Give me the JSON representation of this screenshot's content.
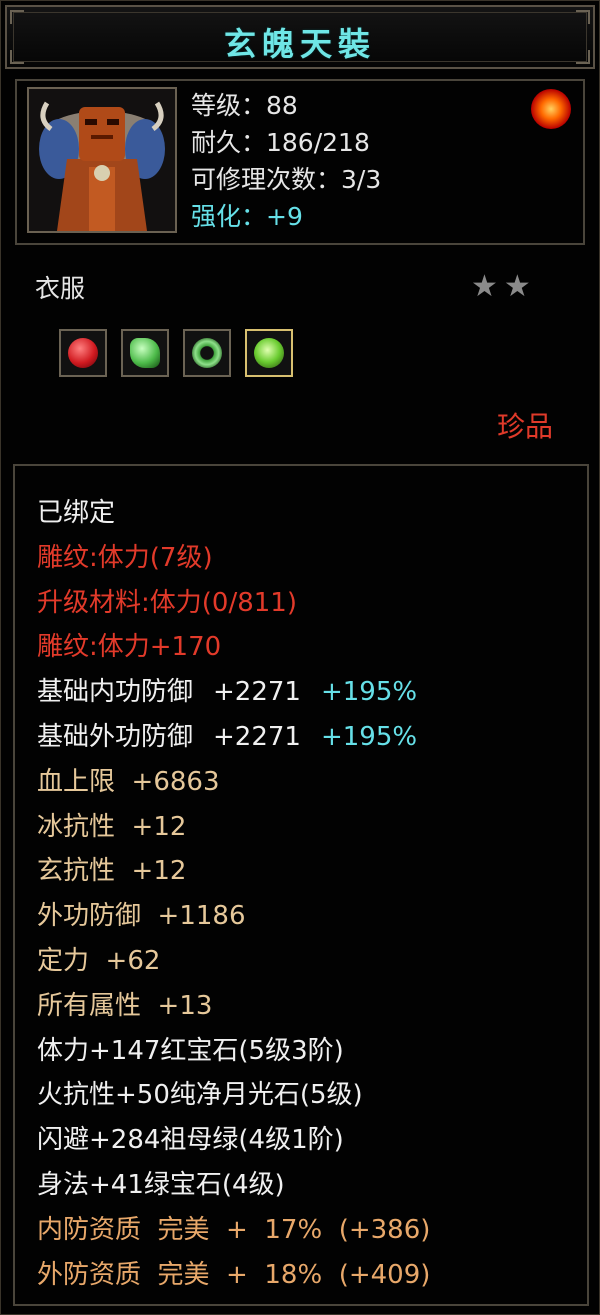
{
  "title": "玄魄天裝",
  "header": {
    "level_label": "等级：88",
    "durability_label": "耐久：186/218",
    "repair_label": "可修理次数：3/3",
    "enhance_label": "强化：+9",
    "portrait_icon": "tribal-mask-armor-icon",
    "orb_icon": "fire-orb-icon"
  },
  "slot": {
    "label": "衣服",
    "stars": "★★",
    "rarity": "珍品"
  },
  "gems": [
    {
      "icon": "red-gem-icon",
      "color": "#d01a20"
    },
    {
      "icon": "green-jade-icon",
      "color": "#4dbb4a"
    },
    {
      "icon": "green-ring-icon",
      "color": "#3fa23c"
    },
    {
      "icon": "green-crystal-icon",
      "color": "#6acc30"
    }
  ],
  "attributes": {
    "bound": "已绑定",
    "carving": "雕纹:体力(7级)",
    "upgrade": "升级材料:体力(0/811)",
    "carving_bonus": "雕纹:体力+170",
    "inner_def": {
      "name": "基础内功防御",
      "value": "+2271",
      "pct": "+195%"
    },
    "outer_def": {
      "name": "基础外功防御",
      "value": "+2271",
      "pct": "+195%"
    },
    "hp": "血上限  +6863",
    "ice_res": "冰抗性  +12",
    "xuan_res": "玄抗性  +12",
    "outer_attack_def": "外功防御  +1186",
    "focus": "定力  +62",
    "all_attr": "所有属性  +13",
    "gem1": "体力+147红宝石(5级3阶)",
    "gem2": "火抗性+50纯净月光石(5级)",
    "gem3": "闪避+284祖母绿(4级1阶)",
    "gem4": "身法+41绿宝石(4级)",
    "inner_quality": "内防资质  完美  +  17%  (+386)",
    "outer_quality": "外防资质  完美  +  18%  (+409)"
  },
  "colors": {
    "title": "#6fe6e6",
    "red": "#e23a2a",
    "gold": "#e6c89a",
    "cyan": "#66e0e8",
    "orange": "#e8a86a"
  }
}
